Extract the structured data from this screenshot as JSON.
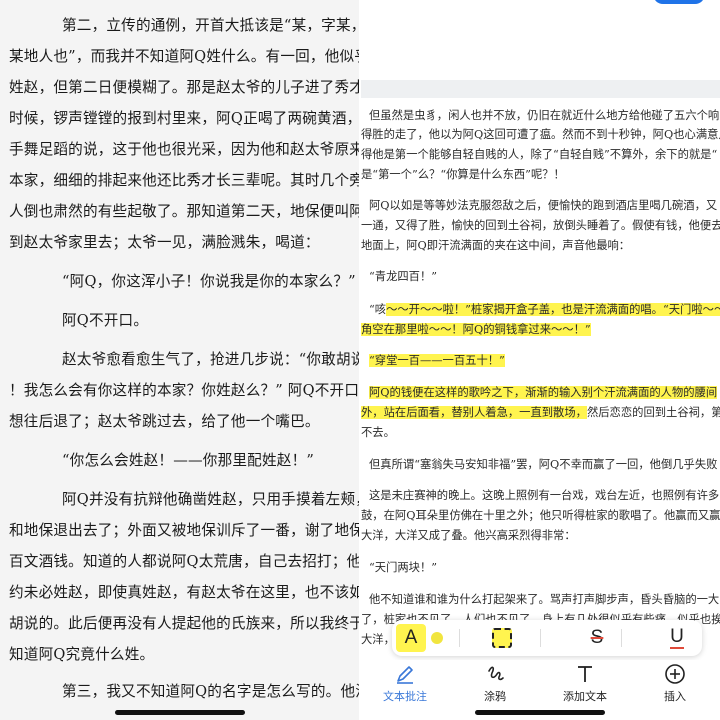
{
  "reader": {
    "paragraphs": [
      {
        "lines": [
          "第二，立传的通例，开首大抵该是“某，字某，",
          "某地人也”，而我并不知道阿Q姓什么。有一回，他似乎是",
          "姓赵，但第二日便模糊了。那是赵太爷的儿子进了秀才的",
          "时候，锣声镗镗的报到村里来，阿Q正喝了两碗黄酒，便",
          "手舞足蹈的说，这于他也很光采，因为他和赵太爷原来是",
          "本家，细细的排起来他还比秀才长三辈呢。其时几个旁听",
          "人倒也肃然的有些起敬了。那知道第二天，地保便叫阿Q",
          "到赵太爷家里去；太爷一见，满脸溅朱，喝道："
        ]
      },
      {
        "lines": [
          "“阿Q，你这浑小子！你说我是你的本家么？”"
        ]
      },
      {
        "lines": [
          "阿Q不开口。"
        ]
      },
      {
        "lines": [
          "赵太爷愈看愈生气了，抢进几步说：“你敢胡说",
          "！我怎么会有你这样的本家？你姓赵么？”    阿Q不开口，",
          "想往后退了；赵太爷跳过去，给了他一个嘴巴。"
        ]
      },
      {
        "lines": [
          "“你怎么会姓赵！——你那里配姓赵！”"
        ]
      },
      {
        "lines": [
          "阿Q并没有抗辩他确凿姓赵，只用手摸着左颊，",
          "和地保退出去了；外面又被地保训斥了一番，谢了地保二",
          "百文酒钱。知道的人都说阿Q太荒唐，自己去招打；他大",
          "约未必姓赵，即使真姓赵，有赵太爷在这里，也不该如此",
          "胡说的。此后便再没有人提起他的氏族来，所以我终于不",
          "知道阿Q究竟什么姓。"
        ]
      },
      {
        "lines": [
          "第三，我又不知道阿Q的名字是怎么写的。他活"
        ]
      }
    ]
  },
  "annotator": {
    "doc_lines": [
      {
        "segments": [
          {
            "t": "但虽然是虫豸，闲人也并不放，仍旧在就近什么地方给他碰了五六个响",
            "h": false
          }
        ]
      },
      {
        "segments": [
          {
            "t": "得胜的走了，他以为阿Q这回可遭了瘟。然而不到十秒钟，阿Q也心满意足",
            "h": false
          }
        ]
      },
      {
        "segments": [
          {
            "t": "得他是第一个能够自轻自贱的人，除了“自轻自贱”不算外，余下的就是“",
            "h": false
          }
        ]
      },
      {
        "segments": [
          {
            "t": "是“第一个”么？“你算是什么东西”呢？！",
            "h": false
          }
        ]
      },
      {
        "segments": [
          {
            "t": "阿Q以如是等等妙法克服怨敌之后，便愉快的跑到酒店里喝几碗酒，又",
            "h": false
          }
        ]
      },
      {
        "segments": [
          {
            "t": "一通，又得了胜，愉快的回到土谷祠，放倒头睡着了。假使有钱，他便去",
            "h": false
          }
        ]
      },
      {
        "segments": [
          {
            "t": "地面上，阿Q即汗流满面的夹在这中间，声音他最响：",
            "h": false
          }
        ]
      },
      {
        "segments": [
          {
            "t": "“青龙四百！”",
            "h": false
          }
        ]
      },
      {
        "segments": [
          {
            "t": "“咳",
            "h": false
          },
          {
            "t": "～～开～～啦！”桩家揭开盒子盖，也是汗流满面的唱。“天门啦～～",
            "h": true
          }
        ]
      },
      {
        "segments": [
          {
            "t": "角空在那里啦～～！阿Q的铜钱拿过来～～！”",
            "h": true
          }
        ]
      },
      {
        "segments": [
          {
            "t": "“穿堂一百——一百五十！”",
            "h": true
          }
        ]
      },
      {
        "segments": [
          {
            "t": "阿Q的钱便在这样的歌吟之下，渐渐的输入别个汗流满面的人物的腰间",
            "h": true
          }
        ]
      },
      {
        "segments": [
          {
            "t": "外，站在后面看，替别人着急，一直到散场，",
            "h": true
          },
          {
            "t": "然后恋恋的回到土谷祠，第",
            "h": false
          }
        ]
      },
      {
        "segments": [
          {
            "t": "不去。",
            "h": false
          }
        ]
      },
      {
        "segments": [
          {
            "t": "但真所谓“塞翁失马安知非福”罢，阿Q不幸而赢了一回，他倒几乎失败",
            "h": false
          }
        ]
      },
      {
        "segments": [
          {
            "t": "这是未庄赛神的晚上。这晚上照例有一台戏，戏台左近，也照例有许多",
            "h": false
          }
        ]
      },
      {
        "segments": [
          {
            "t": "鼓，在阿Q耳朵里仿佛在十里之外；他只听得桩家的歌唱了。他赢而又赢",
            "h": false
          }
        ]
      },
      {
        "segments": [
          {
            "t": "大洋，大洋又成了叠。他兴高采烈得非常：",
            "h": false
          }
        ]
      },
      {
        "segments": [
          {
            "t": "“天门两块！”",
            "h": false
          }
        ]
      },
      {
        "segments": [
          {
            "t": "他不知道谁和谁为什么打起架来了。骂声打声脚步声，昏头昏脑的一大",
            "h": false
          }
        ]
      },
      {
        "segments": [
          {
            "t": "了，桩家也不见了，人们也不见了，身上有几处很似乎有些痛，似乎也挨",
            "h": false
          }
        ]
      },
      {
        "segments": [
          {
            "t": "大洋，许到赌摊不见了……",
            "h": false
          }
        ]
      }
    ],
    "toolbar": {
      "tools": [
        {
          "name": "text-highlight-tool",
          "glyph": "A"
        },
        {
          "name": "highlight-color-dot",
          "glyph": ""
        },
        {
          "name": "area-highlight-tool",
          "glyph": ""
        },
        {
          "name": "strikethrough-tool",
          "glyph": "S"
        },
        {
          "name": "underline-tool",
          "glyph": "U"
        }
      ]
    },
    "bottom_nav": [
      {
        "label": "文本批注",
        "icon": "pen-icon",
        "active": true
      },
      {
        "label": "涂鸦",
        "icon": "scribble-icon",
        "active": false
      },
      {
        "label": "添加文本",
        "icon": "text-T-icon",
        "active": false
      },
      {
        "label": "插入",
        "icon": "plus-circle-icon",
        "active": false
      }
    ],
    "colors": {
      "highlight": "#fff44f",
      "accent": "#3a78d8",
      "blue_button": "#1f73e8",
      "band_gray": "#eef0f2"
    }
  }
}
